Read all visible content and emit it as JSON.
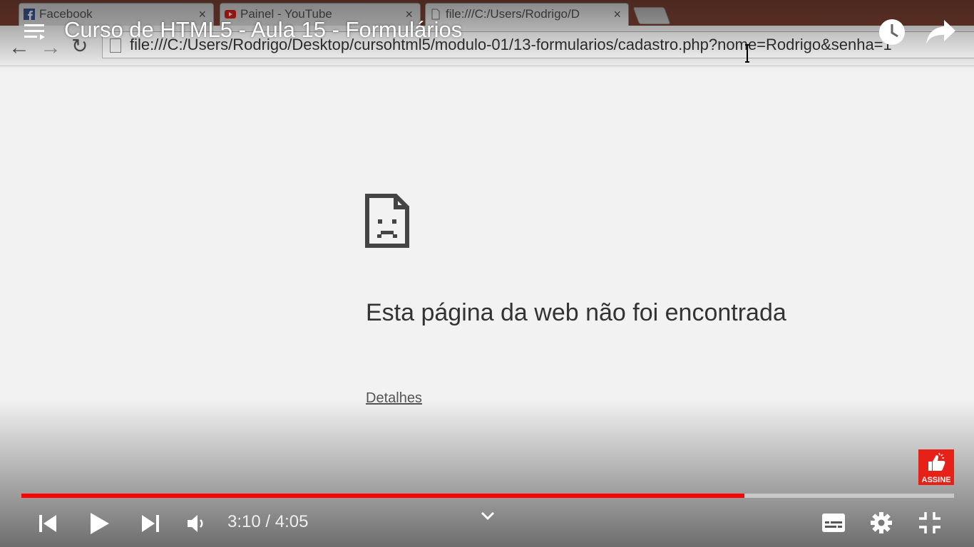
{
  "browser": {
    "tabs": [
      {
        "label": "Facebook"
      },
      {
        "label": "Painel - YouTube"
      },
      {
        "label": "file:///C:/Users/Rodrigo/D"
      }
    ],
    "url": "file:///C:/Users/Rodrigo/Desktop/cursohtml5/modulo-01/13-formularios/cadastro.php?nome=Rodrigo&senha=1"
  },
  "player": {
    "title": "Curso de HTML5 - Aula 15 - Formulários",
    "time": "3:10 / 4:05",
    "progress": 0.775,
    "subscribe_label": "ASSINE",
    "accent_color": "#ff0000"
  },
  "error_page": {
    "title": "Esta página da web não foi encontrada",
    "details_link": "Detalhes"
  }
}
